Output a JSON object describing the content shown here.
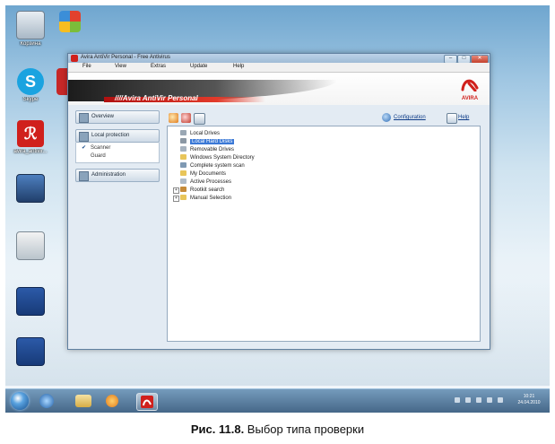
{
  "window": {
    "title": "Avira AntiVir Personal - Free Antivirus",
    "buttons": [
      "–",
      "□",
      "✕"
    ]
  },
  "menu": [
    "File",
    "View",
    "Extras",
    "Update",
    "Help"
  ],
  "banner": {
    "product": "////Avira AntiVir Personal",
    "logo_text": "AVIRA"
  },
  "nav": {
    "overview": "Overview",
    "local_protection": "Local protection",
    "items": [
      "Scanner",
      "Guard"
    ],
    "administration": "Administration"
  },
  "toolbar": {
    "configuration": "Configuration",
    "help": "Help"
  },
  "tree": [
    {
      "label": "Local Drives",
      "selected": false
    },
    {
      "label": "Local Hard Disks",
      "selected": true
    },
    {
      "label": "Removable Drives",
      "selected": false
    },
    {
      "label": "Windows System Directory",
      "selected": false
    },
    {
      "label": "Complete system scan",
      "selected": false
    },
    {
      "label": "My Documents",
      "selected": false
    },
    {
      "label": "Active Processes",
      "selected": false
    },
    {
      "label": "Rootkit search",
      "selected": false
    },
    {
      "label": "Manual Selection",
      "selected": false
    }
  ],
  "desktop_icons": [
    "Корзина",
    "",
    "Skype",
    "",
    "avira_antivir...",
    "",
    "",
    "",
    ""
  ],
  "clock": {
    "time": "10:21",
    "date": "24.04.2010"
  },
  "caption": {
    "figure": "Рис. 11.8.",
    "text": " Выбор типа проверки"
  },
  "colors": {
    "accent_red": "#d0201c",
    "selection": "#3a78d6"
  }
}
